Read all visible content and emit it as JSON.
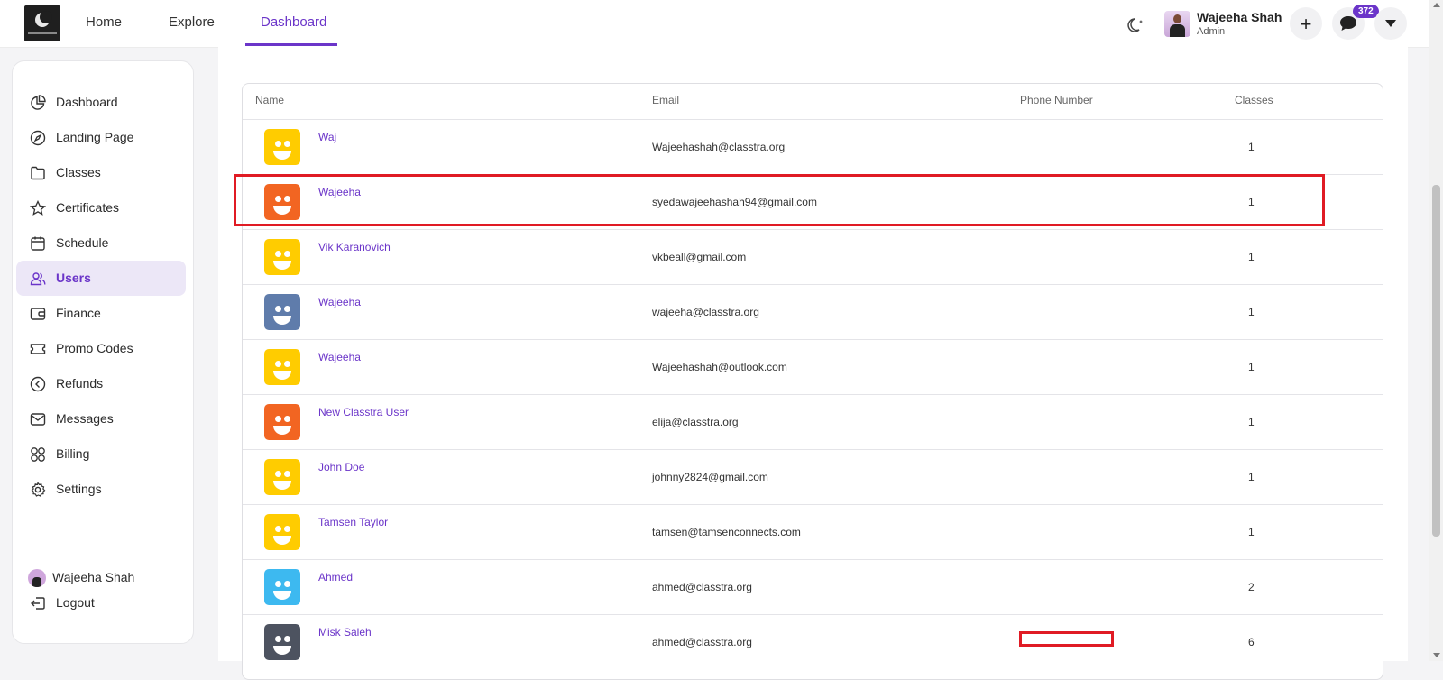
{
  "nav": {
    "home": "Home",
    "explore": "Explore",
    "dashboard": "Dashboard"
  },
  "profile": {
    "name": "Wajeeha Shah",
    "role": "Admin",
    "notification_count": "372"
  },
  "sidebar": {
    "items": [
      {
        "label": "Dashboard",
        "icon": "pie-chart-icon"
      },
      {
        "label": "Landing Page",
        "icon": "compass-icon"
      },
      {
        "label": "Classes",
        "icon": "folder-icon"
      },
      {
        "label": "Certificates",
        "icon": "star-icon"
      },
      {
        "label": "Schedule",
        "icon": "calendar-icon"
      },
      {
        "label": "Users",
        "icon": "users-icon",
        "active": true
      },
      {
        "label": "Finance",
        "icon": "wallet-icon"
      },
      {
        "label": "Promo Codes",
        "icon": "ticket-icon"
      },
      {
        "label": "Refunds",
        "icon": "refund-icon"
      },
      {
        "label": "Messages",
        "icon": "mail-icon"
      },
      {
        "label": "Billing",
        "icon": "grid-icon"
      },
      {
        "label": "Settings",
        "icon": "gear-icon"
      }
    ],
    "footer_user": "Wajeeha Shah",
    "logout": "Logout"
  },
  "table": {
    "headers": {
      "name": "Name",
      "email": "Email",
      "phone": "Phone Number",
      "classes": "Classes"
    },
    "rows": [
      {
        "name": "Waj",
        "email": "Wajeehashah@classtra.org",
        "classes": "1",
        "avatar_color": "#FFCC00"
      },
      {
        "name": "Wajeeha",
        "email": "syedawajeehashah94@gmail.com",
        "classes": "1",
        "avatar_color": "#F26522"
      },
      {
        "name": "Vik Karanovich",
        "email": "vkbeall@gmail.com",
        "classes": "1",
        "avatar_color": "#FFCC00"
      },
      {
        "name": "Wajeeha",
        "email": "wajeeha@classtra.org",
        "classes": "1",
        "avatar_color": "#5F7CAB"
      },
      {
        "name": "Wajeeha",
        "email": "Wajeehashah@outlook.com",
        "classes": "1",
        "avatar_color": "#FFCC00"
      },
      {
        "name": "New Classtra User",
        "email": "elija@classtra.org",
        "classes": "1",
        "avatar_color": "#F26522"
      },
      {
        "name": "John Doe",
        "email": "johnny2824@gmail.com",
        "classes": "1",
        "avatar_color": "#FFCC00"
      },
      {
        "name": "Tamsen Taylor",
        "email": "tamsen@tamsenconnects.com",
        "classes": "1",
        "avatar_color": "#FFCC00"
      },
      {
        "name": "Ahmed",
        "email": "ahmed@classtra.org",
        "classes": "2",
        "avatar_color": "#3DB9F0"
      },
      {
        "name": "Misk Saleh",
        "email": "ahmed@classtra.org",
        "classes": "6",
        "avatar_color": "#4D5360"
      }
    ]
  },
  "colors": {
    "accent": "#6B35C9",
    "highlight": "#E01B24"
  }
}
